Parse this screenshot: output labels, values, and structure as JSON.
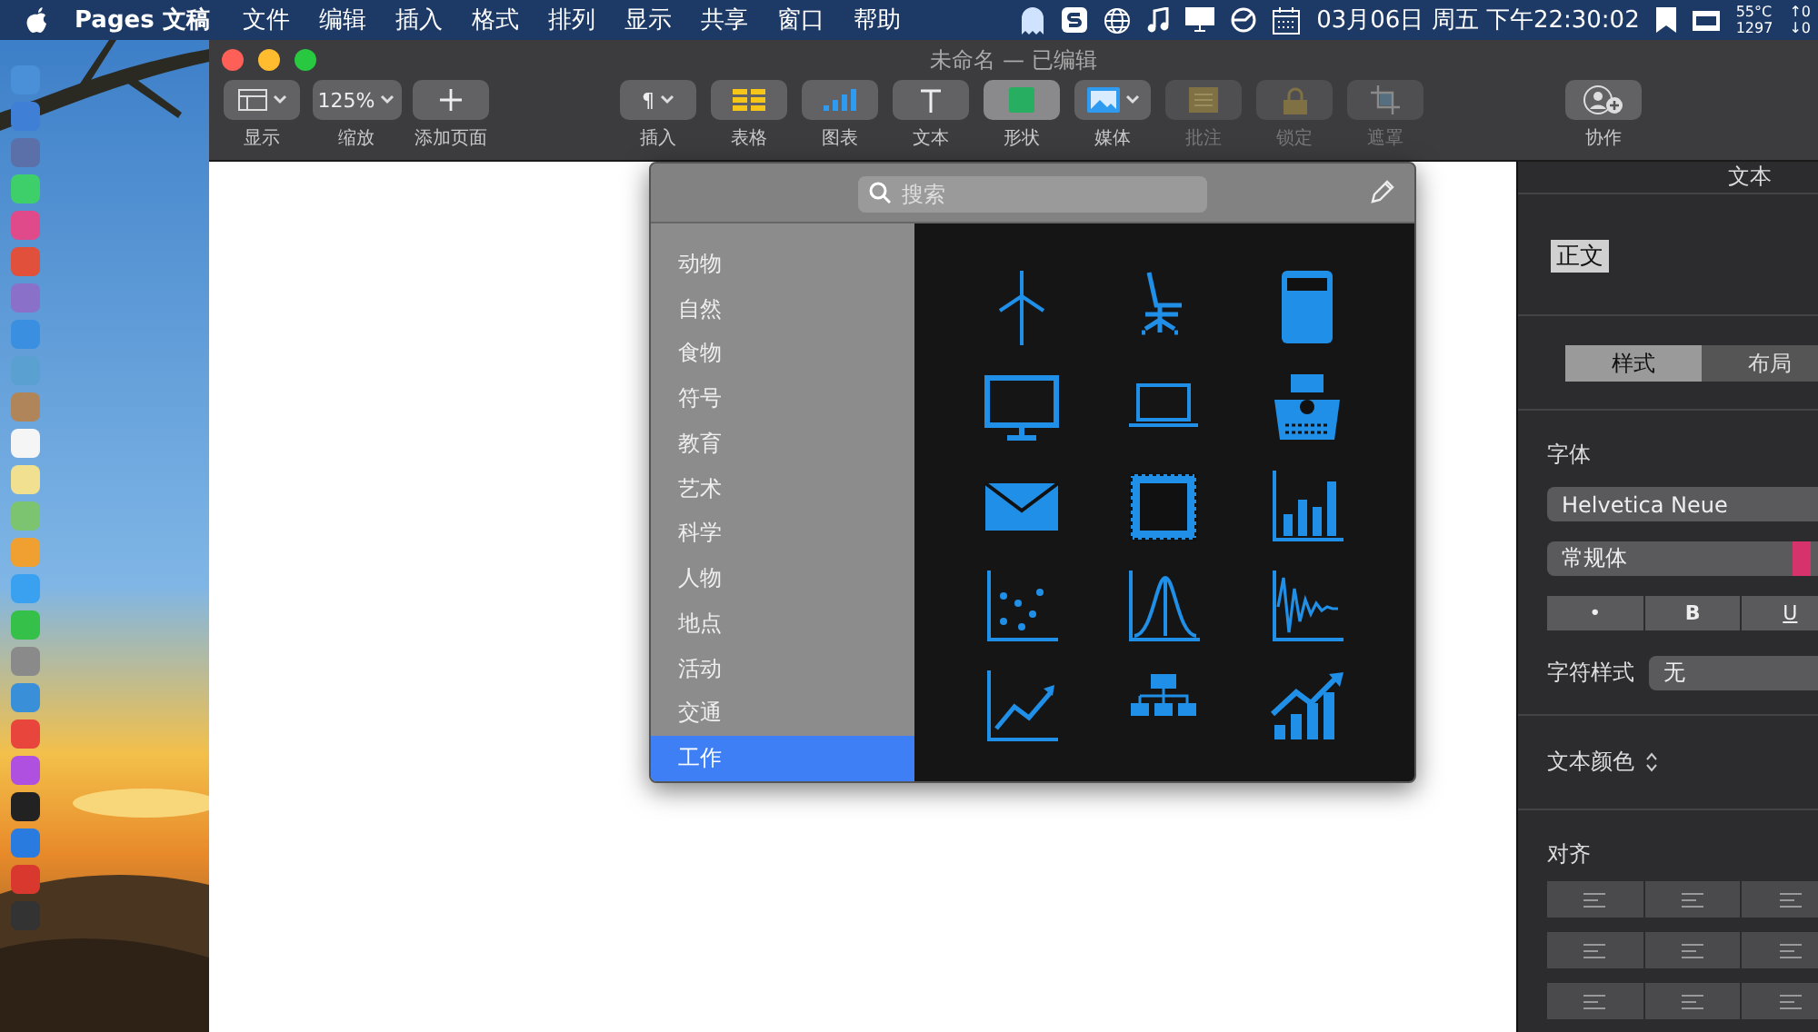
{
  "menu_bar": {
    "app_name": "Pages 文稿",
    "menus": [
      "文件",
      "编辑",
      "插入",
      "格式",
      "排列",
      "显示",
      "共享",
      "窗口",
      "帮助"
    ],
    "clock": "03月06日 周五 下午22:30:02",
    "temperature": "55°C",
    "fan_speed": "1297",
    "network_up": "↑0",
    "network_down": "↓0"
  },
  "window": {
    "title": "未命名 — 已编辑"
  },
  "toolbar": [
    {
      "label": "显示",
      "caret": true,
      "selected": false,
      "disabled": false
    },
    {
      "label": "缩放",
      "value": "125%",
      "caret": true,
      "selected": false,
      "disabled": false
    },
    {
      "label": "添加页面",
      "caret": false,
      "selected": false,
      "disabled": false
    },
    {
      "label": "插入",
      "value": "¶",
      "caret": true,
      "selected": false,
      "disabled": false
    },
    {
      "label": "表格",
      "caret": false,
      "selected": false,
      "disabled": false
    },
    {
      "label": "图表",
      "caret": false,
      "selected": false,
      "disabled": false
    },
    {
      "label": "文本",
      "caret": false,
      "selected": false,
      "disabled": false
    },
    {
      "label": "形状",
      "caret": false,
      "selected": true,
      "disabled": false
    },
    {
      "label": "媒体",
      "caret": true,
      "selected": false,
      "disabled": false
    },
    {
      "label": "批注",
      "caret": false,
      "selected": false,
      "disabled": true
    },
    {
      "label": "锁定",
      "caret": false,
      "selected": false,
      "disabled": true
    },
    {
      "label": "遮罩",
      "caret": false,
      "selected": false,
      "disabled": true
    },
    {
      "label": "协作",
      "caret": false,
      "selected": false,
      "disabled": false
    }
  ],
  "shape_popup": {
    "search": {
      "placeholder": "搜索"
    },
    "categories": [
      {
        "label": "动物",
        "selected": false
      },
      {
        "label": "自然",
        "selected": false
      },
      {
        "label": "食物",
        "selected": false
      },
      {
        "label": "符号",
        "selected": false
      },
      {
        "label": "教育",
        "selected": false
      },
      {
        "label": "艺术",
        "selected": false
      },
      {
        "label": "科学",
        "selected": false
      },
      {
        "label": "人物",
        "selected": false
      },
      {
        "label": "地点",
        "selected": false
      },
      {
        "label": "活动",
        "selected": false
      },
      {
        "label": "交通",
        "selected": false
      },
      {
        "label": "工作",
        "selected": true
      }
    ]
  },
  "inspector": {
    "title": "文本",
    "paragraph_style": "正文",
    "tabs": [
      {
        "label": "样式",
        "selected": true
      },
      {
        "label": "布局",
        "selected": false
      }
    ],
    "font_label": "字体",
    "font_family": "Helvetica Neue",
    "font_style": "常规体",
    "style_buttons": [
      "•",
      "B",
      "U"
    ],
    "char_style_label": "字符样式",
    "char_style": "无",
    "text_color_label": "文本颜色",
    "alignment_label": "对齐"
  }
}
